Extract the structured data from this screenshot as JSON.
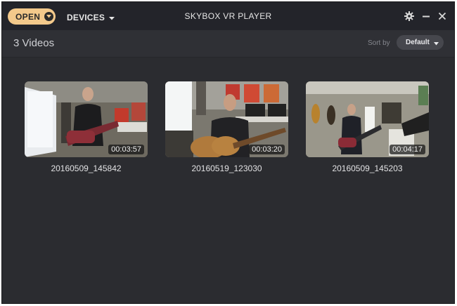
{
  "header": {
    "open_label": "OPEN",
    "devices_label": "DEVICES",
    "app_title": "SKYBOX VR PLAYER",
    "controls": [
      "gear-icon",
      "minimize-icon",
      "close-icon"
    ]
  },
  "library": {
    "count_label": "3 Videos",
    "sort_label": "Sort by",
    "sort_value": "Default"
  },
  "videos": [
    {
      "name": "20160509_145842",
      "duration": "00:03:57"
    },
    {
      "name": "20160519_123030",
      "duration": "00:03:20"
    },
    {
      "name": "20160509_145203",
      "duration": "00:04:17"
    }
  ],
  "colors": {
    "accent": "#f3c98b",
    "background": "#2b2c30",
    "titlebar": "#23242a"
  }
}
